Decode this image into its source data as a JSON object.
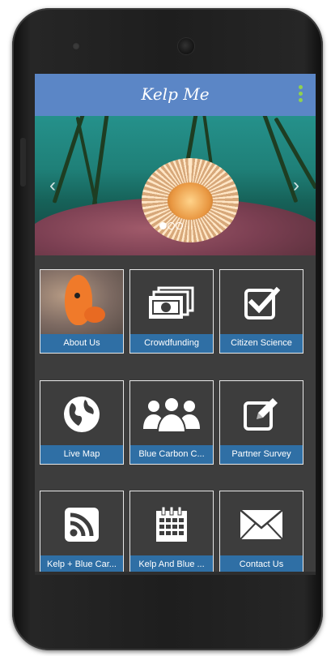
{
  "app": {
    "title": "Kelp Me"
  },
  "slider": {
    "prev_label": "‹",
    "next_label": "›",
    "slide_count": 3,
    "active_slide": 1
  },
  "tiles": [
    {
      "label": "About Us",
      "icon": "fish-photo"
    },
    {
      "label": "Crowdfunding",
      "icon": "money-stack-icon"
    },
    {
      "label": "Citizen Science",
      "icon": "checkbox-icon"
    },
    {
      "label": "Live Map",
      "icon": "globe-icon"
    },
    {
      "label": "Blue Carbon C...",
      "icon": "people-group-icon"
    },
    {
      "label": "Partner Survey",
      "icon": "edit-icon"
    },
    {
      "label": "Kelp + Blue Car...",
      "icon": "rss-icon"
    },
    {
      "label": "Kelp And Blue ...",
      "icon": "calendar-icon"
    },
    {
      "label": "Contact Us",
      "icon": "envelope-icon"
    }
  ],
  "colors": {
    "appbar": "#5b86c6",
    "tile_caption": "#2f6fa5",
    "screen_bg": "#3d3d3d",
    "menu_dots": "#8fd14f"
  }
}
